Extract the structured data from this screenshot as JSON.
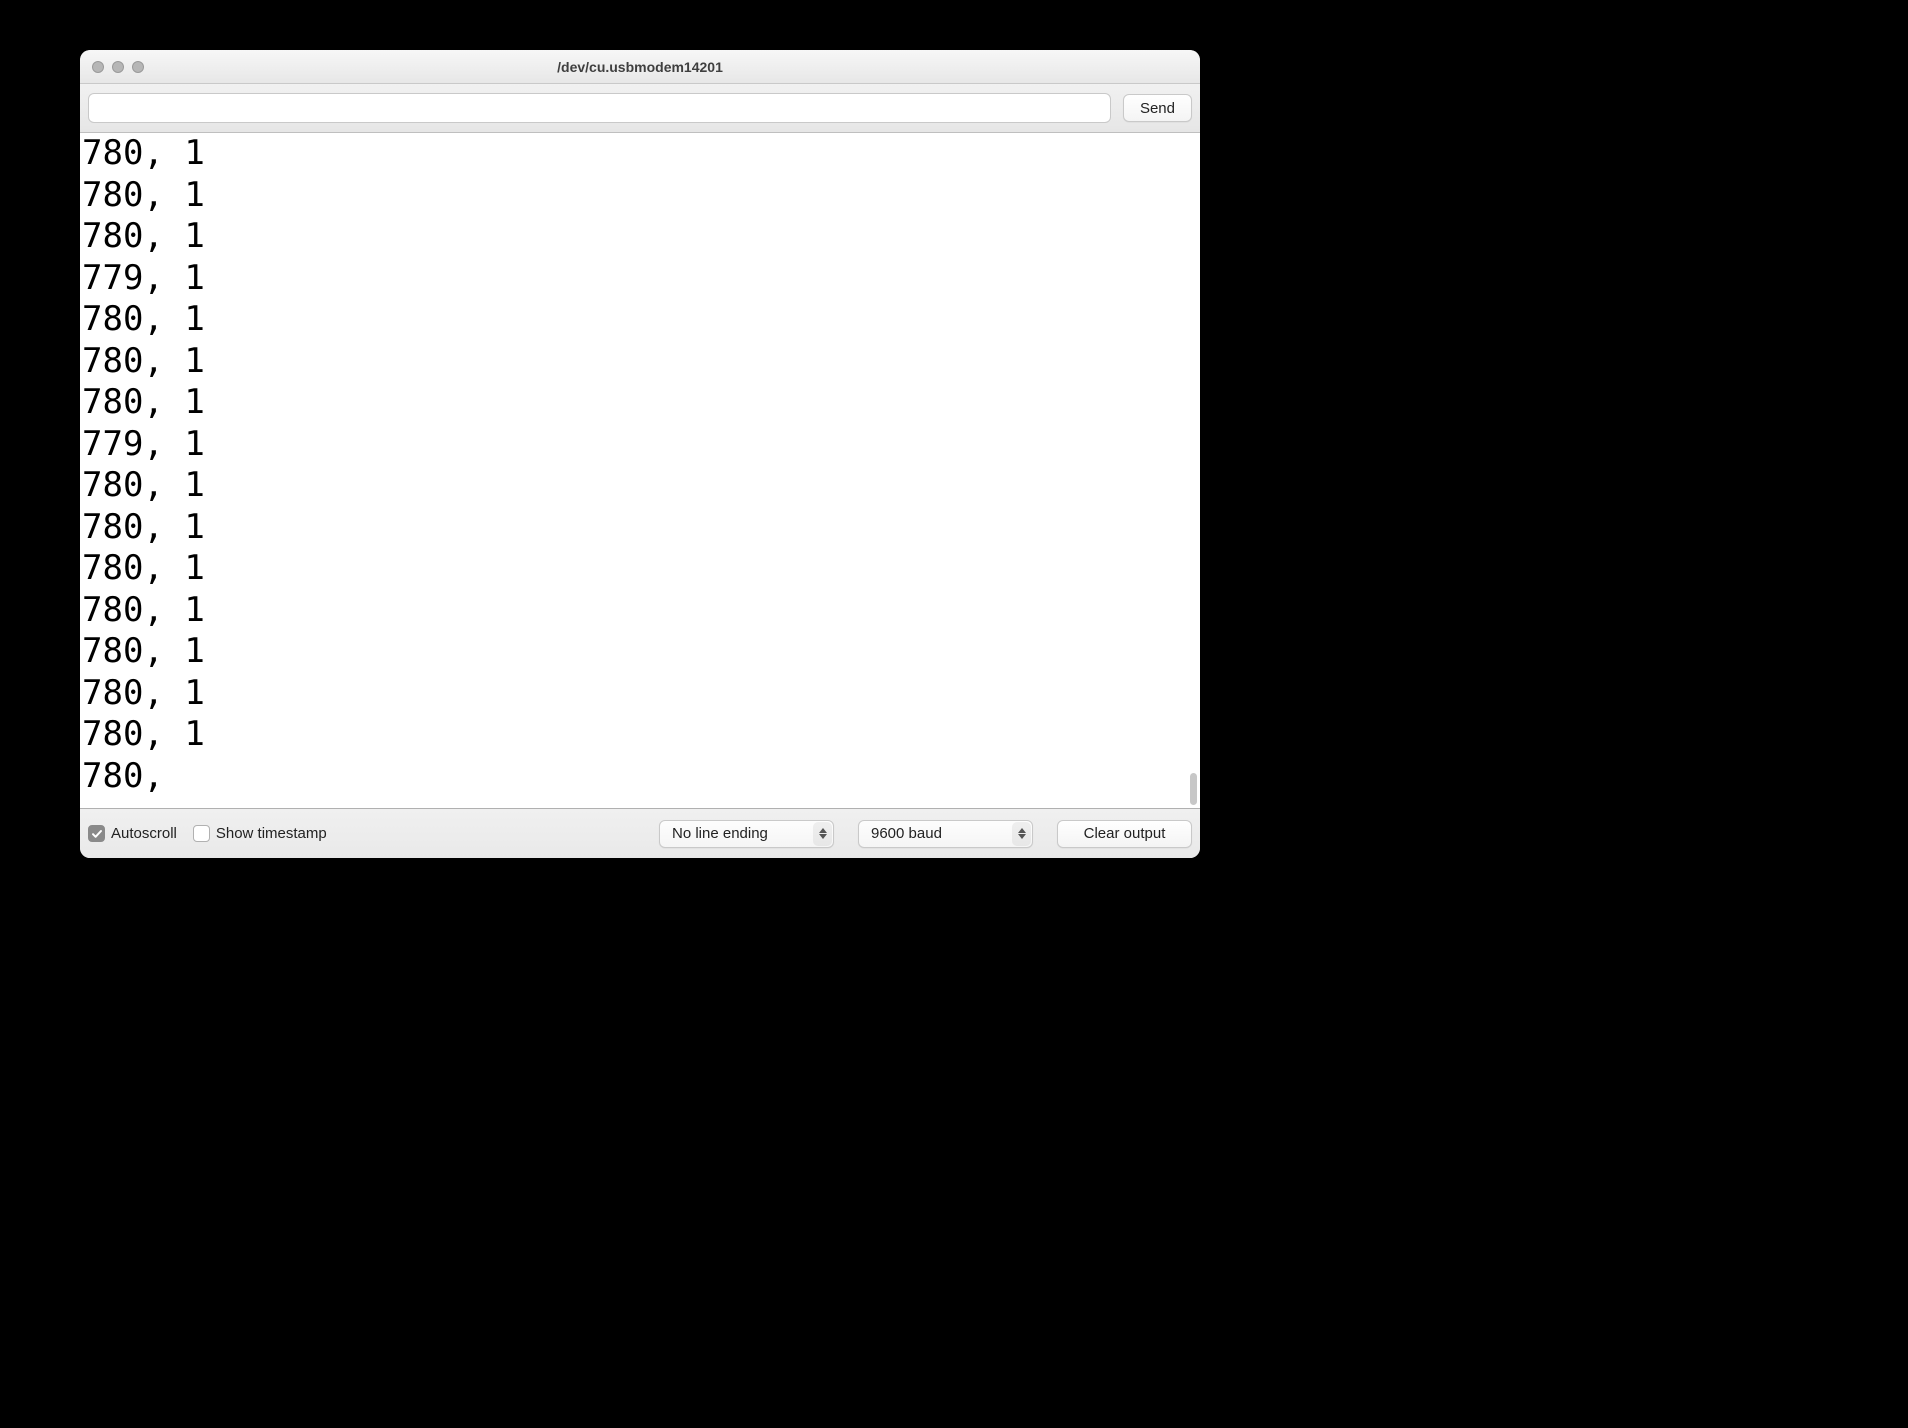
{
  "window": {
    "title": "/dev/cu.usbmodem14201"
  },
  "send_button": "Send",
  "input_value": "",
  "output_lines": [
    "780, 1",
    "780, 1",
    "780, 1",
    "779, 1",
    "780, 1",
    "780, 1",
    "780, 1",
    "779, 1",
    "780, 1",
    "780, 1",
    "780, 1",
    "780, 1",
    "780, 1",
    "780, 1",
    "780, 1",
    "780,"
  ],
  "bottom": {
    "autoscroll_label": "Autoscroll",
    "autoscroll_checked": true,
    "timestamp_label": "Show timestamp",
    "timestamp_checked": false,
    "line_ending_selected": "No line ending",
    "baud_selected": "9600 baud",
    "clear_label": "Clear output"
  }
}
